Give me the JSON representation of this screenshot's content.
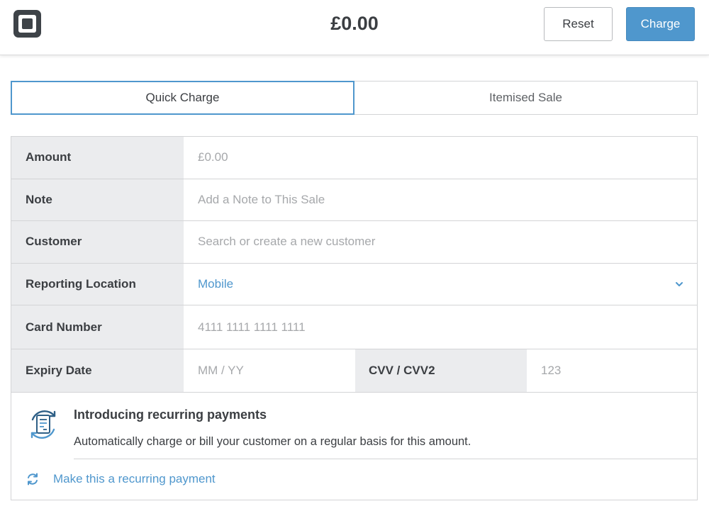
{
  "header": {
    "total": "£0.00",
    "reset_label": "Reset",
    "charge_label": "Charge"
  },
  "tabs": [
    {
      "label": "Quick Charge",
      "active": true
    },
    {
      "label": "Itemised Sale",
      "active": false
    }
  ],
  "form": {
    "amount_label": "Amount",
    "amount_placeholder": "£0.00",
    "note_label": "Note",
    "note_placeholder": "Add a Note to This Sale",
    "customer_label": "Customer",
    "customer_placeholder": "Search or create a new customer",
    "location_label": "Reporting Location",
    "location_value": "Mobile",
    "card_label": "Card Number",
    "card_placeholder": "4111 1111 1111 1111",
    "expiry_label": "Expiry Date",
    "expiry_placeholder": "MM / YY",
    "cvv_label": "CVV / CVV2",
    "cvv_placeholder": "123"
  },
  "promo": {
    "title": "Introducing recurring payments",
    "description": "Automatically charge or bill your customer on a regular basis for this amount.",
    "link_label": "Make this a recurring payment",
    "icon": "recurring-invoice-icon"
  },
  "colors": {
    "accent": "#4f97cd",
    "label_bg": "#ebecee",
    "text": "#3b3e42"
  }
}
